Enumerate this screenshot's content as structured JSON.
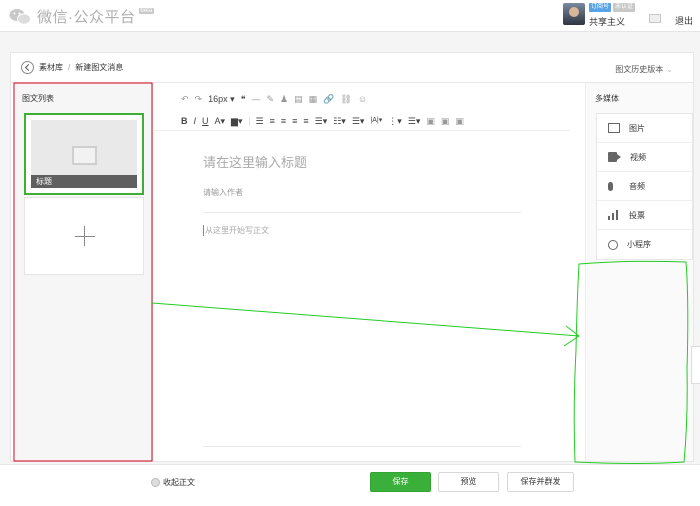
{
  "topbar": {
    "brand": "微信·公众平台",
    "beta": "beta",
    "badges": [
      "订阅号",
      "未认证"
    ],
    "username": "共享主义",
    "logout": "退出"
  },
  "breadcrumb": {
    "parent": "素材库",
    "separator": "/",
    "current": "新建图文消息"
  },
  "history_label": "图文历史版本",
  "article_list": {
    "title": "图文列表",
    "card_caption": "标题"
  },
  "editor": {
    "font_size": "16px",
    "title_placeholder": "请在这里输入标题",
    "author_placeholder": "请输入作者",
    "body_placeholder": "从这里开始写正文"
  },
  "media": {
    "title": "多媒体",
    "items": [
      {
        "label": "图片",
        "icon": "image-icon"
      },
      {
        "label": "视频",
        "icon": "video-icon"
      },
      {
        "label": "音频",
        "icon": "audio-icon"
      },
      {
        "label": "投票",
        "icon": "vote-icon"
      },
      {
        "label": "小程序",
        "icon": "mini-program-icon"
      }
    ]
  },
  "footer": {
    "collapse_label": "收起正文",
    "save": "保存",
    "preview": "预览",
    "save_publish": "保存并群发"
  },
  "annotation_colors": {
    "red_box": "#d0021b",
    "green": "#22cc22",
    "brand_green": "#3ab03a"
  }
}
